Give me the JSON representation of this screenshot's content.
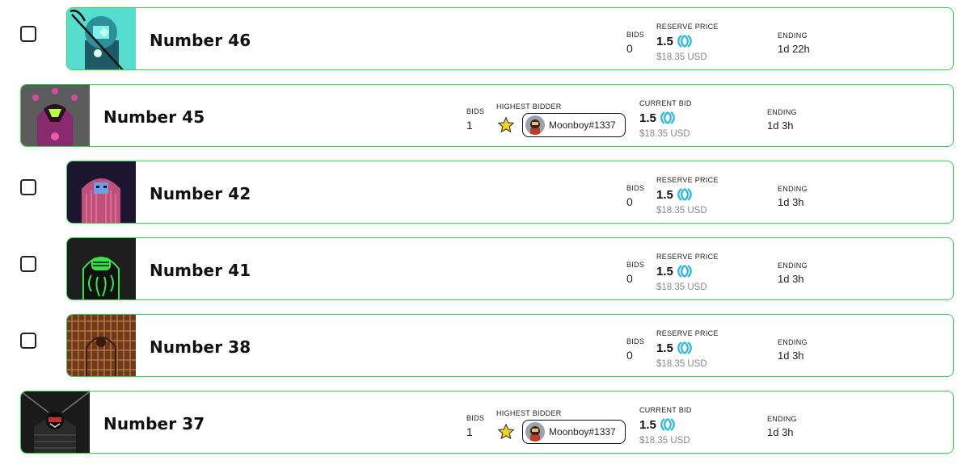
{
  "listings": [
    {
      "title": "Number 46",
      "bids_label": "BIDS",
      "bids": "0",
      "price_label": "RESERVE PRICE",
      "price": "1.5",
      "usd": "$18.35 USD",
      "ending_label": "ENDING",
      "ending": "1d 22h"
    },
    {
      "title": "Number 45",
      "bids_label": "BIDS",
      "bids": "1",
      "bidder_label": "HIGHEST BIDDER",
      "bidder": "Moonboy#1337",
      "price_label": "CURRENT BID",
      "price": "1.5",
      "usd": "$18.35 USD",
      "ending_label": "ENDING",
      "ending": "1d 3h"
    },
    {
      "title": "Number 42",
      "bids_label": "BIDS",
      "bids": "0",
      "price_label": "RESERVE PRICE",
      "price": "1.5",
      "usd": "$18.35 USD",
      "ending_label": "ENDING",
      "ending": "1d 3h"
    },
    {
      "title": "Number 41",
      "bids_label": "BIDS",
      "bids": "0",
      "price_label": "RESERVE PRICE",
      "price": "1.5",
      "usd": "$18.35 USD",
      "ending_label": "ENDING",
      "ending": "1d 3h"
    },
    {
      "title": "Number 38",
      "bids_label": "BIDS",
      "bids": "0",
      "price_label": "RESERVE PRICE",
      "price": "1.5",
      "usd": "$18.35 USD",
      "ending_label": "ENDING",
      "ending": "1d 3h"
    },
    {
      "title": "Number 37",
      "bids_label": "BIDS",
      "bids": "1",
      "bidder_label": "HIGHEST BIDDER",
      "bidder": "Moonboy#1337",
      "price_label": "CURRENT BID",
      "price": "1.5",
      "usd": "$18.35 USD",
      "ending_label": "ENDING",
      "ending": "1d 3h"
    }
  ],
  "colors": {
    "border": "#39d353",
    "coin": "#2ab8e6",
    "star": "#f7d21e"
  },
  "icons": {
    "coin": "currency-coin-icon",
    "star": "star-icon"
  }
}
